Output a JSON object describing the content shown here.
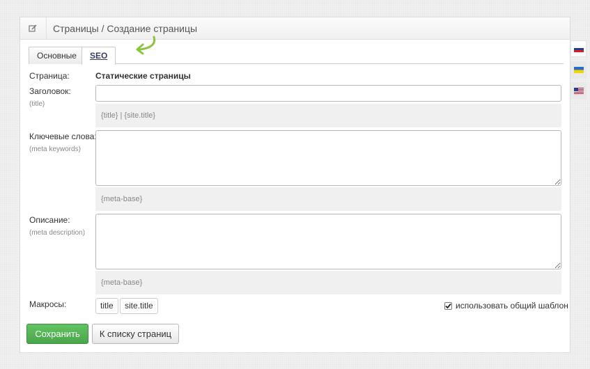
{
  "header": {
    "icon": "edit-icon",
    "title": "Страницы / Создание страницы"
  },
  "tabs": [
    {
      "label": "Основные",
      "active": false
    },
    {
      "label": "SEO",
      "active": true
    }
  ],
  "form": {
    "page_label": "Страница:",
    "page_value": "Статические страницы",
    "title_label": "Заголовок:",
    "title_sub": "(title)",
    "title_value": "",
    "title_hint": "{title} | {site.title}",
    "keywords_label": "Ключевые слова:",
    "keywords_sub": "(meta keywords)",
    "keywords_value": "",
    "keywords_hint": "{meta-base}",
    "description_label": "Описание:",
    "description_sub": "(meta description)",
    "description_value": "",
    "description_hint": "{meta-base}",
    "macros_label": "Макросы:",
    "macros": [
      "title",
      "site.title"
    ],
    "use_template_label": "использовать общий шаблон",
    "use_template_checked": true
  },
  "buttons": {
    "save": "Сохранить",
    "back": "К списку страниц"
  },
  "languages": [
    {
      "code": "ru",
      "active": true
    },
    {
      "code": "ua",
      "active": false
    },
    {
      "code": "us",
      "active": false
    }
  ],
  "colors": {
    "save_button": "#4cae4c",
    "arrow": "#8cc63f"
  }
}
